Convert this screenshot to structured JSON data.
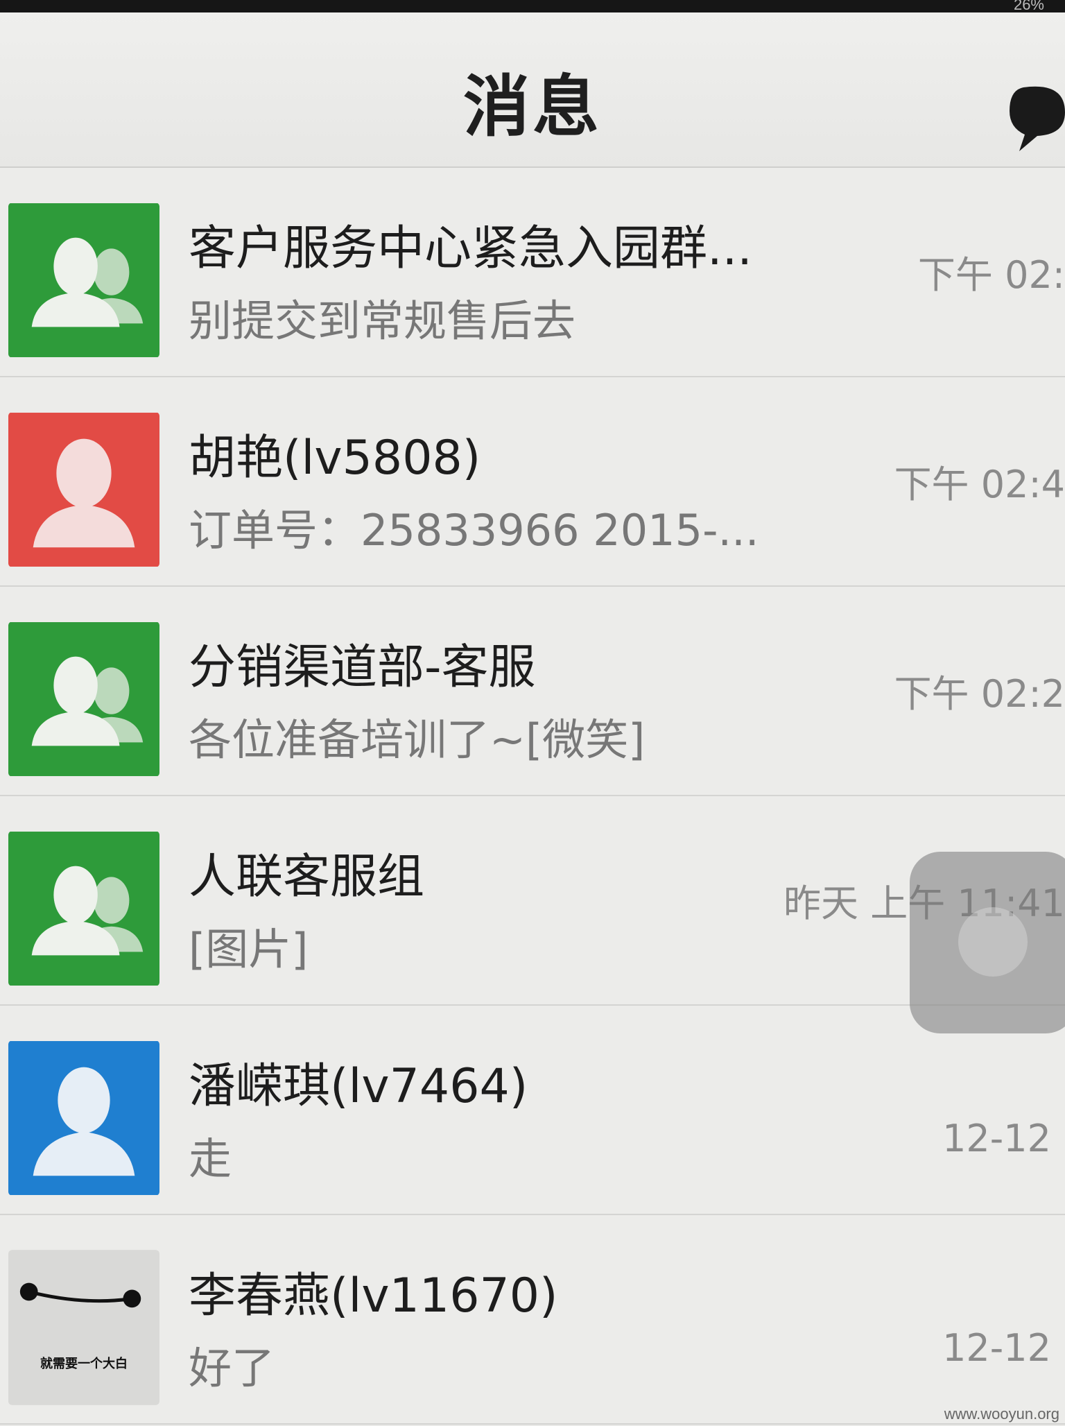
{
  "status": {
    "battery": "26%"
  },
  "header": {
    "title": "消息",
    "icon": "chat-bubble-icon"
  },
  "conversations": [
    {
      "name": "客户服务中心紧急入园群...",
      "preview": "别提交到常规售后去",
      "time": "下午 02:",
      "avatar": "group",
      "color": "#2e9b3a"
    },
    {
      "name": "胡艳(lv5808)",
      "preview": "订单号：25833966  2015-...",
      "time": "下午 02:4",
      "avatar": "person",
      "color": "#e24b45"
    },
    {
      "name": "分销渠道部-客服",
      "preview": "各位准备培训了~[微笑]",
      "time": "下午 02:2",
      "avatar": "group",
      "color": "#2e9b3a"
    },
    {
      "name": "人联客服组",
      "preview": "[图片]",
      "time": "昨天 上午 11:41",
      "avatar": "group",
      "color": "#2e9b3a"
    },
    {
      "name": "潘嵘琪(lv7464)",
      "preview": "走",
      "time": "12-12",
      "avatar": "person",
      "color": "#1f7fd0"
    },
    {
      "name": "李春燕(lv11670)",
      "preview": "好了",
      "time": "12-12",
      "avatar": "custom",
      "avatar_caption": "就需要一个大白",
      "color": "#dcdcda"
    }
  ],
  "watermark": "www.wooyun.org"
}
